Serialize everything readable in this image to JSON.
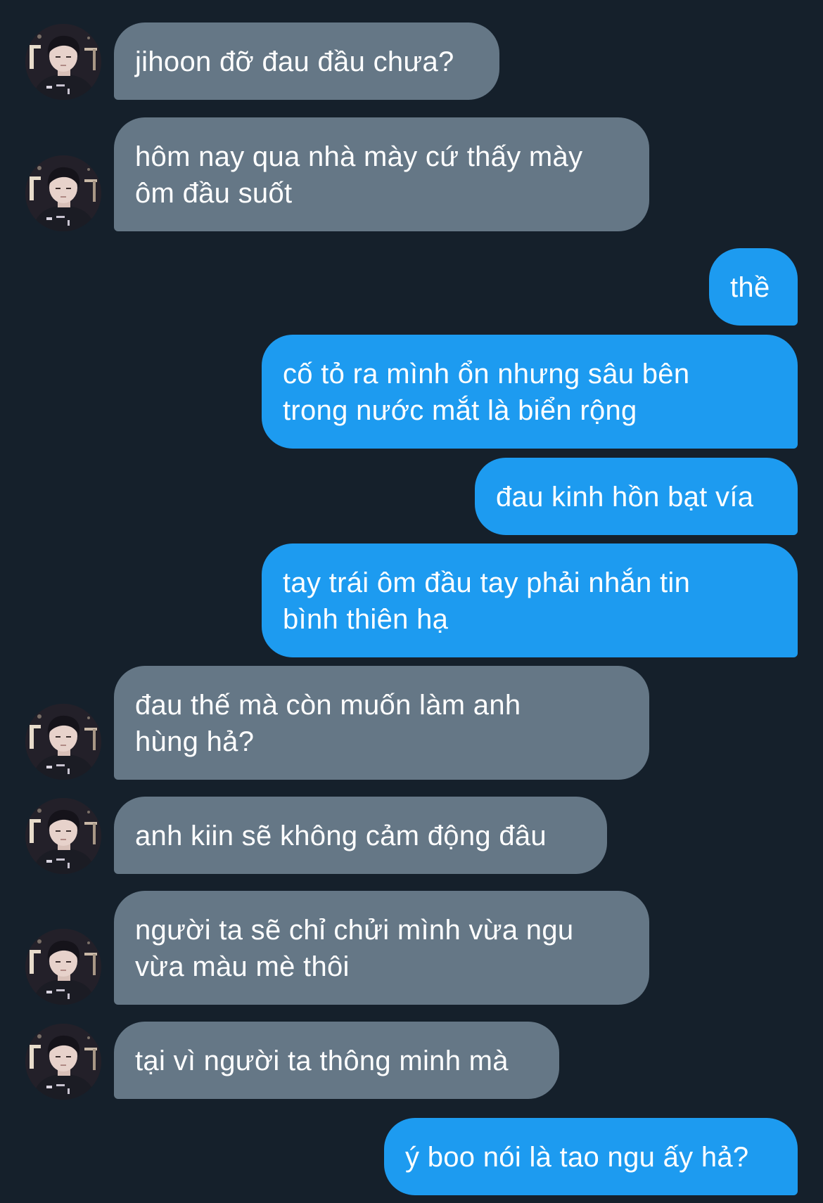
{
  "colors": {
    "background": "#15202b",
    "received_bubble": "#657786",
    "sent_bubble": "#1d9bf0",
    "text": "#ffffff"
  },
  "icons": {
    "avatar": "contact-avatar-photo"
  },
  "messages": [
    {
      "sender": "other",
      "text": "jihoon đỡ đau đầu chưa?"
    },
    {
      "sender": "other",
      "text": "hôm nay qua nhà mày cứ thấy mày\nôm đầu suốt"
    },
    {
      "sender": "me",
      "text": "thề"
    },
    {
      "sender": "me",
      "text": "cố tỏ ra mình ổn nhưng sâu bên\ntrong nước mắt là biển rộng"
    },
    {
      "sender": "me",
      "text": "đau kinh hồn bạt vía"
    },
    {
      "sender": "me",
      "text": "tay trái ôm đầu tay phải nhắn tin\nbình thiên hạ"
    },
    {
      "sender": "other",
      "text": "đau thế mà còn muốn làm anh\nhùng hả?"
    },
    {
      "sender": "other",
      "text": "anh kiin sẽ không cảm động đâu"
    },
    {
      "sender": "other",
      "text": "người ta sẽ chỉ chửi mình vừa ngu\nvừa màu mè thôi"
    },
    {
      "sender": "other",
      "text": "tại vì người ta thông minh mà"
    },
    {
      "sender": "me",
      "text": "ý boo nói là tao ngu ấy hả?"
    }
  ]
}
